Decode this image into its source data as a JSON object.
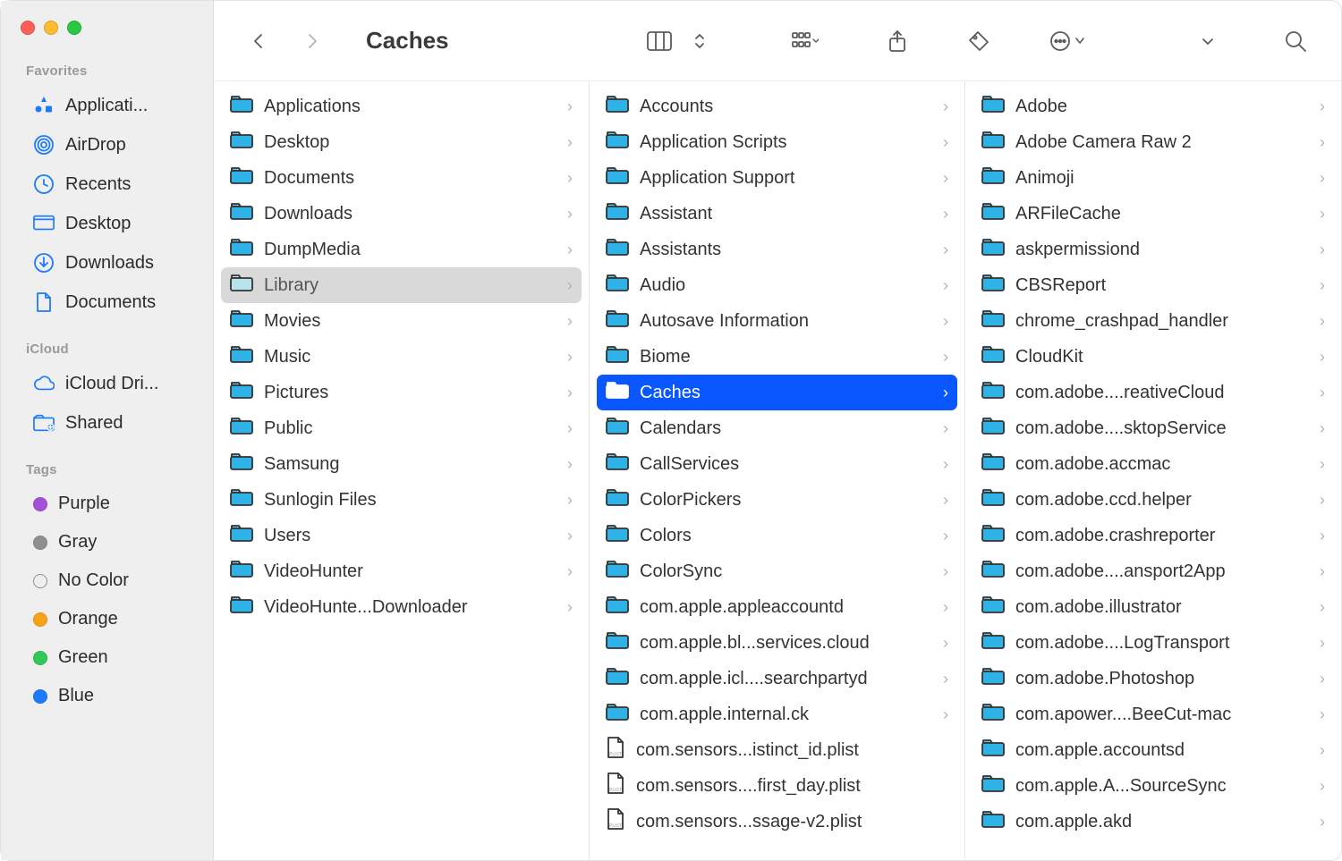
{
  "window": {
    "title": "Caches"
  },
  "traffic": {
    "close": "#ff5f57",
    "min": "#febc2e",
    "max": "#28c840"
  },
  "sidebar": {
    "sections": [
      {
        "heading": "Favorites",
        "items": [
          {
            "label": "Applicati...",
            "icon": "apps"
          },
          {
            "label": "AirDrop",
            "icon": "airdrop"
          },
          {
            "label": "Recents",
            "icon": "clock"
          },
          {
            "label": "Desktop",
            "icon": "desktop"
          },
          {
            "label": "Downloads",
            "icon": "download"
          },
          {
            "label": "Documents",
            "icon": "doc"
          }
        ]
      },
      {
        "heading": "iCloud",
        "items": [
          {
            "label": "iCloud Dri...",
            "icon": "cloud"
          },
          {
            "label": "Shared",
            "icon": "shared"
          }
        ]
      },
      {
        "heading": "Tags",
        "items": [
          {
            "label": "Purple",
            "icon": "tag",
            "color": "#a450d8"
          },
          {
            "label": "Gray",
            "icon": "tag",
            "color": "#8e8e93"
          },
          {
            "label": "No Color",
            "icon": "tag",
            "color": "transparent"
          },
          {
            "label": "Orange",
            "icon": "tag",
            "color": "#f6a318"
          },
          {
            "label": "Green",
            "icon": "tag",
            "color": "#32c759"
          },
          {
            "label": "Blue",
            "icon": "tag",
            "color": "#1d7aff"
          }
        ]
      }
    ]
  },
  "columns": [
    {
      "items": [
        {
          "name": "Applications",
          "type": "folder"
        },
        {
          "name": "Desktop",
          "type": "folder"
        },
        {
          "name": "Documents",
          "type": "folder"
        },
        {
          "name": "Downloads",
          "type": "folder"
        },
        {
          "name": "DumpMedia",
          "type": "folder"
        },
        {
          "name": "Library",
          "type": "folder",
          "state": "open"
        },
        {
          "name": "Movies",
          "type": "folder"
        },
        {
          "name": "Music",
          "type": "folder"
        },
        {
          "name": "Pictures",
          "type": "folder"
        },
        {
          "name": "Public",
          "type": "folder"
        },
        {
          "name": "Samsung",
          "type": "folder"
        },
        {
          "name": "Sunlogin Files",
          "type": "folder"
        },
        {
          "name": "Users",
          "type": "folder"
        },
        {
          "name": "VideoHunter",
          "type": "folder"
        },
        {
          "name": "VideoHunte...Downloader",
          "type": "folder"
        }
      ]
    },
    {
      "items": [
        {
          "name": "Accounts",
          "type": "folder"
        },
        {
          "name": "Application Scripts",
          "type": "folder"
        },
        {
          "name": "Application Support",
          "type": "folder"
        },
        {
          "name": "Assistant",
          "type": "folder"
        },
        {
          "name": "Assistants",
          "type": "folder"
        },
        {
          "name": "Audio",
          "type": "folder"
        },
        {
          "name": "Autosave Information",
          "type": "folder"
        },
        {
          "name": "Biome",
          "type": "folder"
        },
        {
          "name": "Caches",
          "type": "folder",
          "state": "selected"
        },
        {
          "name": "Calendars",
          "type": "folder"
        },
        {
          "name": "CallServices",
          "type": "folder"
        },
        {
          "name": "ColorPickers",
          "type": "folder"
        },
        {
          "name": "Colors",
          "type": "folder"
        },
        {
          "name": "ColorSync",
          "type": "folder"
        },
        {
          "name": "com.apple.appleaccountd",
          "type": "folder"
        },
        {
          "name": "com.apple.bl...services.cloud",
          "type": "folder"
        },
        {
          "name": "com.apple.icl....searchpartyd",
          "type": "folder"
        },
        {
          "name": "com.apple.internal.ck",
          "type": "folder"
        },
        {
          "name": "com.sensors...istinct_id.plist",
          "type": "file"
        },
        {
          "name": "com.sensors....first_day.plist",
          "type": "file"
        },
        {
          "name": "com.sensors...ssage-v2.plist",
          "type": "file"
        }
      ]
    },
    {
      "items": [
        {
          "name": "Adobe",
          "type": "folder"
        },
        {
          "name": "Adobe Camera Raw 2",
          "type": "folder"
        },
        {
          "name": "Animoji",
          "type": "folder"
        },
        {
          "name": "ARFileCache",
          "type": "folder"
        },
        {
          "name": "askpermissiond",
          "type": "folder"
        },
        {
          "name": "CBSReport",
          "type": "folder"
        },
        {
          "name": "chrome_crashpad_handler",
          "type": "folder"
        },
        {
          "name": "CloudKit",
          "type": "folder"
        },
        {
          "name": "com.adobe....reativeCloud",
          "type": "folder"
        },
        {
          "name": "com.adobe....sktopService",
          "type": "folder"
        },
        {
          "name": "com.adobe.accmac",
          "type": "folder"
        },
        {
          "name": "com.adobe.ccd.helper",
          "type": "folder"
        },
        {
          "name": "com.adobe.crashreporter",
          "type": "folder"
        },
        {
          "name": "com.adobe....ansport2App",
          "type": "folder"
        },
        {
          "name": "com.adobe.illustrator",
          "type": "folder"
        },
        {
          "name": "com.adobe....LogTransport",
          "type": "folder"
        },
        {
          "name": "com.adobe.Photoshop",
          "type": "folder"
        },
        {
          "name": "com.apower....BeeCut-mac",
          "type": "folder"
        },
        {
          "name": "com.apple.accountsd",
          "type": "folder"
        },
        {
          "name": "com.apple.A...SourceSync",
          "type": "folder"
        },
        {
          "name": "com.apple.akd",
          "type": "folder"
        }
      ]
    }
  ]
}
